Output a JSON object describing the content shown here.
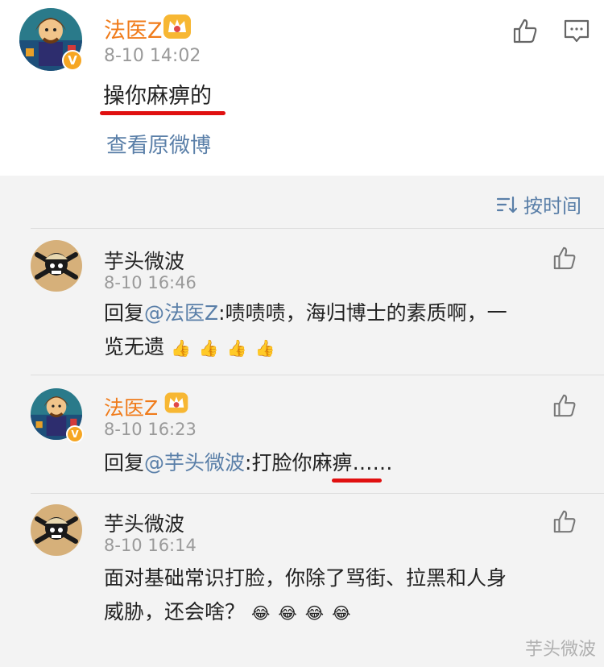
{
  "post": {
    "author": "法医Z",
    "time": "8-10 14:02",
    "text": "操你麻痹的",
    "view_original": "查看原微博",
    "badge": "V"
  },
  "sort": {
    "label": "按时间"
  },
  "comments": [
    {
      "author": "芋头微波",
      "time": "8-10 16:46",
      "reply_prefix": "回复",
      "mention": "@法医Z",
      "text_line1": ":啧啧啧，海归博士的素质啊，一",
      "text_line2": "览无遗",
      "emojis": [
        "👍",
        "👍",
        "👍",
        "👍"
      ]
    },
    {
      "author": "法医Z",
      "time": "8-10 16:23",
      "reply_prefix": "回复",
      "mention": "@芋头微波",
      "text_a": ":打脸你",
      "text_b": "麻痹",
      "text_c": "……",
      "badge": "V"
    },
    {
      "author": "芋头微波",
      "time": "8-10 16:14",
      "text_line1": "面对基础常识打脸，你除了骂街、拉黑和人身",
      "text_line2": "威胁，还会啥？",
      "emojis": [
        "😂",
        "😂",
        "😂",
        "😂"
      ]
    }
  ],
  "watermark": "芋头微波",
  "colors": {
    "orange": "#f07b1a",
    "link": "#5a7fa8",
    "underline": "#e01010",
    "badge": "#f6a623"
  },
  "icons": [
    "thumbs-up-icon",
    "comment-icon",
    "crown-icon",
    "sort-icon",
    "verified-badge"
  ]
}
